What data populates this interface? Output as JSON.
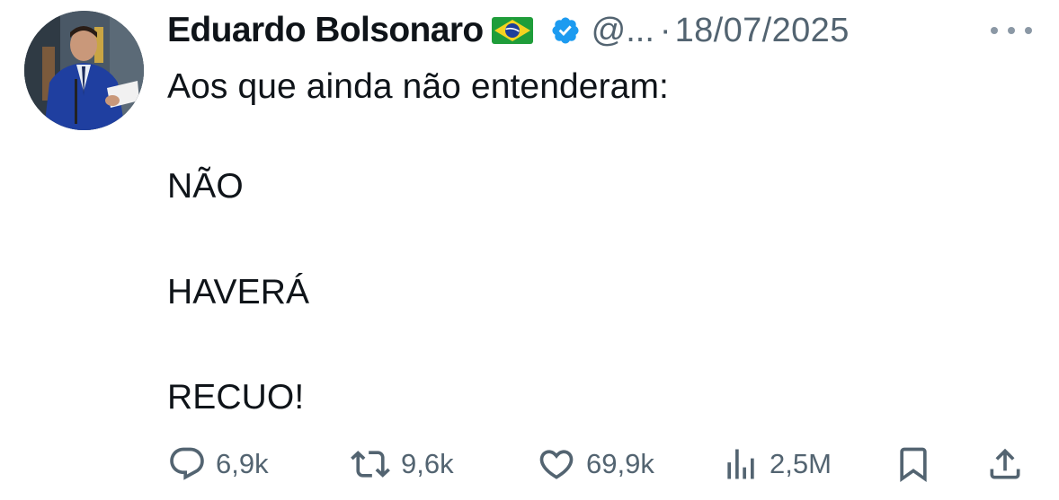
{
  "post": {
    "author_name": "Eduardo Bolsonaro",
    "author_flag": "brazil-flag-emoji",
    "verified_badge": "verified-badge-icon",
    "handle": "@...",
    "separator": "·",
    "date": "18/07/2025",
    "more_menu": "more-options-icon",
    "text_lines": [
      "Aos que ainda não entenderam:",
      "NÃO",
      "HAVERÁ",
      "RECUO!"
    ]
  },
  "actions": {
    "replies": {
      "icon": "reply-icon",
      "count": "6,9k"
    },
    "reposts": {
      "icon": "repost-icon",
      "count": "9,6k"
    },
    "likes": {
      "icon": "heart-icon",
      "count": "69,9k"
    },
    "views": {
      "icon": "views-icon",
      "count": "2,5M"
    },
    "bookmark": {
      "icon": "bookmark-icon"
    },
    "share": {
      "icon": "share-icon"
    }
  },
  "colors": {
    "text_primary": "#0f1419",
    "text_secondary": "#536471",
    "verified_blue": "#1d9bf0",
    "background": "#ffffff"
  }
}
